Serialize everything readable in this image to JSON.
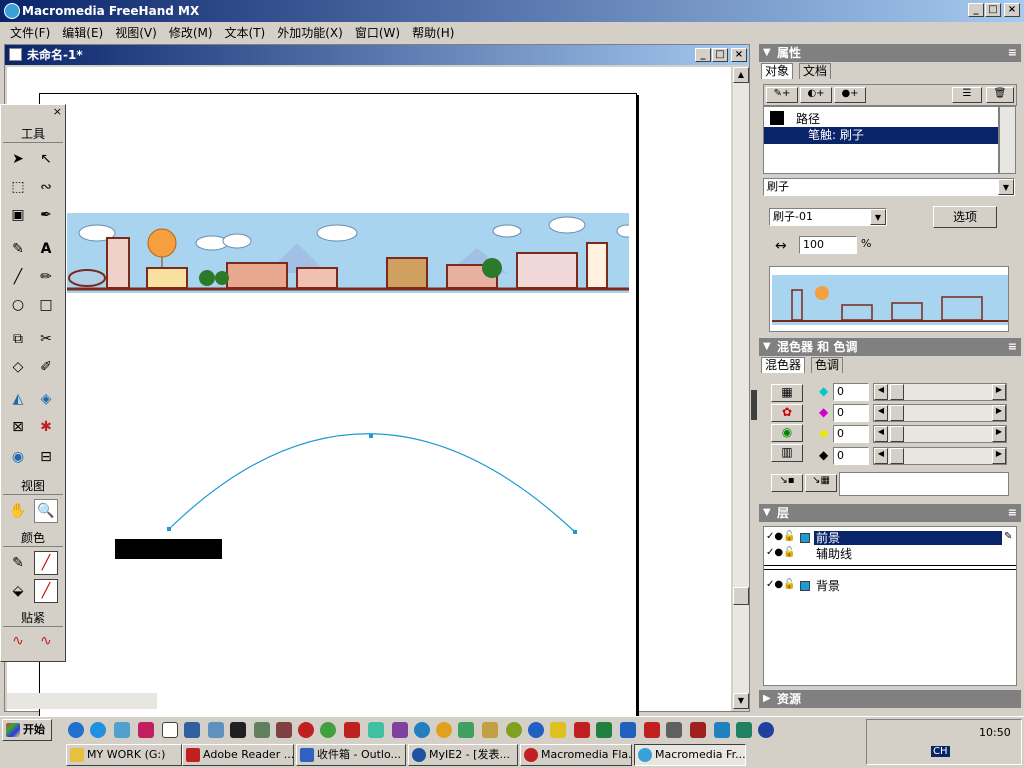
{
  "app": {
    "title": "Macromedia FreeHand MX"
  },
  "menu": [
    "文件(F)",
    "编辑(E)",
    "视图(V)",
    "修改(M)",
    "文本(T)",
    "外加功能(X)",
    "窗口(W)",
    "帮助(H)"
  ],
  "document": {
    "title": "未命名-1*"
  },
  "tools": {
    "header": "工具",
    "view_header": "视图",
    "color_header": "颜色",
    "snap_header": "贴紧"
  },
  "properties": {
    "header": "属性",
    "tabs": [
      "对象",
      "文档"
    ],
    "tree": [
      {
        "label": "路径"
      },
      {
        "label": "笔触: 刷子"
      }
    ],
    "stroke_type": "刷子",
    "brush_name": "刷子-01",
    "options_label": "选项",
    "width_value": "100",
    "width_unit": "%"
  },
  "mixer": {
    "header": "混色器 和 色调",
    "tabs": [
      "混色器",
      "色调"
    ],
    "channels": [
      {
        "value": "0",
        "color": "#00c8c8"
      },
      {
        "value": "0",
        "color": "#d000d0"
      },
      {
        "value": "0",
        "color": "#e8e800"
      },
      {
        "value": "0",
        "color": "#000000"
      }
    ]
  },
  "layers": {
    "header": "层",
    "items": [
      {
        "name": "前景",
        "selected": true
      },
      {
        "name": "辅助线",
        "selected": false
      },
      {
        "name": "背景",
        "selected": false
      }
    ]
  },
  "assets": {
    "header": "资源"
  },
  "taskbar": {
    "start": "开始",
    "time": "10:50",
    "ime": "CH",
    "tasks": [
      {
        "label": "MY WORK (G:)"
      },
      {
        "label": "Adobe Reader ..."
      },
      {
        "label": "收件箱 - Outlo..."
      },
      {
        "label": "MyIE2 - [发表..."
      },
      {
        "label": "Macromedia Fla..."
      },
      {
        "label": "Macromedia Fr..."
      }
    ]
  },
  "colors": {
    "accent": "#0a246a",
    "curve": "#1e9ad6"
  }
}
